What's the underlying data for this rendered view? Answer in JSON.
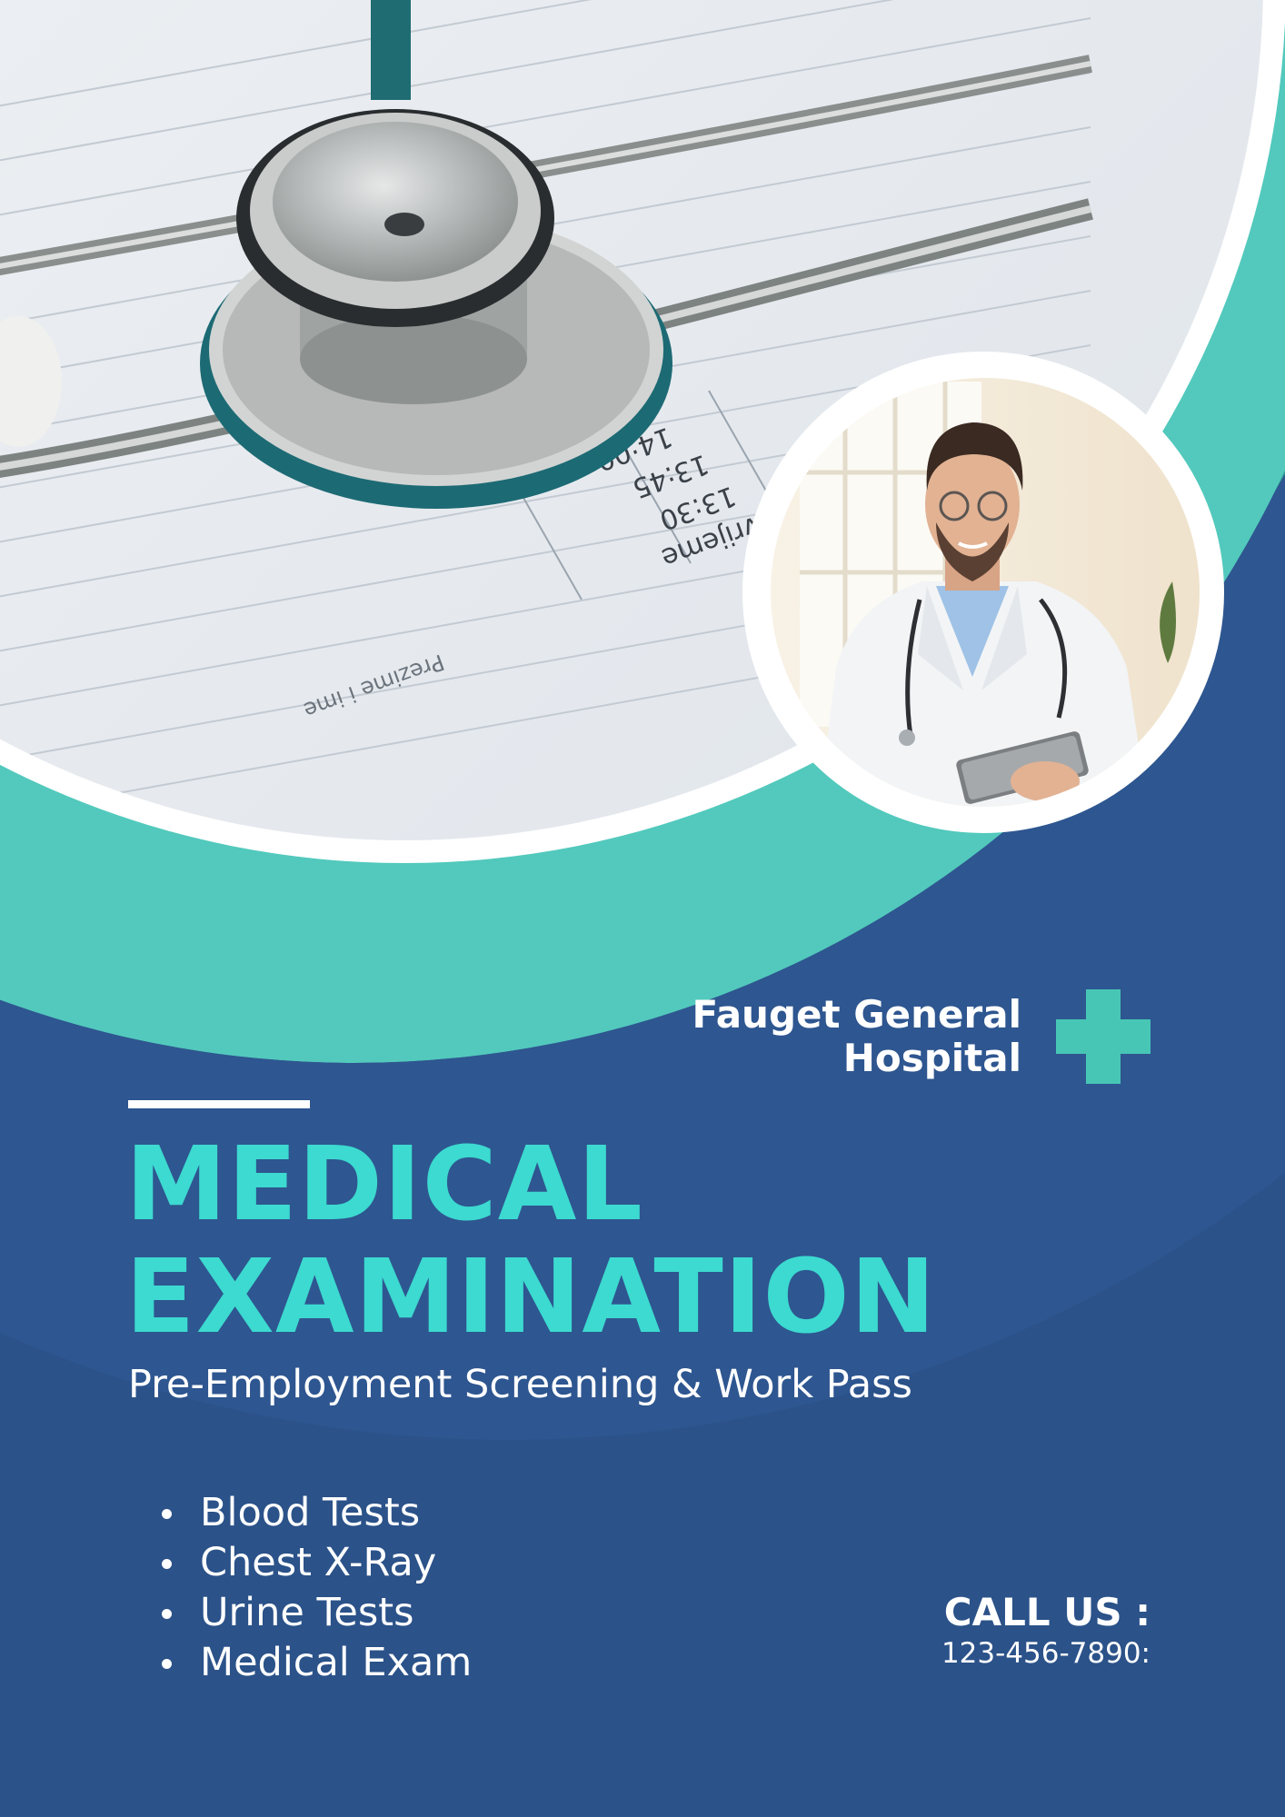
{
  "hospital": {
    "name_line1": "Fauget General",
    "name_line2": "Hospital"
  },
  "title": {
    "line1": "MEDICAL",
    "line2": "EXAMINATION"
  },
  "subtitle": "Pre-Employment Screening & Work Pass",
  "services": [
    "Blood Tests",
    "Chest X-Ray",
    "Urine Tests",
    "Medical Exam"
  ],
  "contact": {
    "label": "CALL US :",
    "phone": "123-456-7890:"
  },
  "photo_chart_text": {
    "time1": "14:00",
    "time2": "13:45",
    "time3": "13:30",
    "word1": "vrijeme",
    "word2": "Prezime i ime"
  },
  "colors": {
    "background": "#2b5289",
    "teal_light": "#52c9bc",
    "teal_dark": "#2f9c92",
    "title_accent": "#3cdad0",
    "cross": "#47c6b5",
    "white": "#ffffff"
  },
  "icons": {
    "brand": "medical-cross-icon",
    "list_marker": "bullet"
  }
}
